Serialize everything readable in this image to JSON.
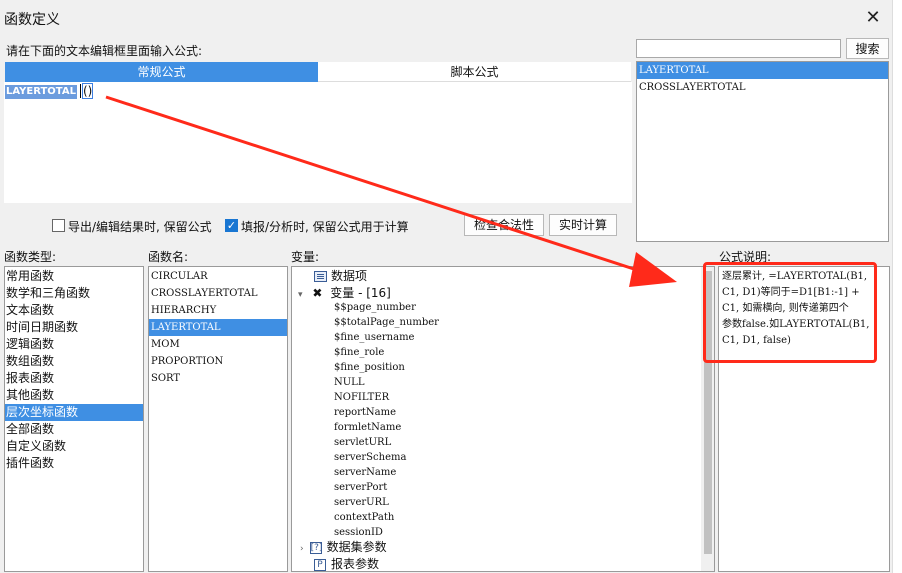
{
  "window": {
    "title": "函数定义",
    "close_label": "✕"
  },
  "prompt": "请在下面的文本编辑框里面输入公式:",
  "tabs": [
    {
      "label": "常规公式"
    },
    {
      "label": "脚本公式"
    }
  ],
  "editor": {
    "selected_text": "LAYERTOTAL",
    "parens": "()"
  },
  "options": {
    "export_keep": {
      "label": "导出/编辑结果时, 保留公式",
      "checked": false
    },
    "fill_keep": {
      "label": "填报/分析时, 保留公式用于计算",
      "checked": true
    }
  },
  "buttons": {
    "check": "检查合法性",
    "realtime": "实时计算",
    "search": "搜索"
  },
  "search": {
    "value": ""
  },
  "search_results": [
    "LAYERTOTAL",
    "CROSSLAYERTOTAL"
  ],
  "labels": {
    "func_type": "函数类型:",
    "func_name": "函数名:",
    "variables": "变量:",
    "description": "公式说明:"
  },
  "func_types": [
    "常用函数",
    "数学和三角函数",
    "文本函数",
    "时间日期函数",
    "逻辑函数",
    "数组函数",
    "报表函数",
    "其他函数",
    "层次坐标函数",
    "全部函数",
    "自定义函数",
    "插件函数"
  ],
  "func_names": [
    "CIRCULAR",
    "CROSSLAYERTOTAL",
    "HIERARCHY",
    "LAYERTOTAL",
    "MOM",
    "PROPORTION",
    "SORT"
  ],
  "variables": {
    "data_item": "数据项",
    "var_group": "变量 - [16]",
    "var_items": [
      "$$page_number",
      "$$totalPage_number",
      "$fine_username",
      "$fine_role",
      "$fine_position",
      "NULL",
      "NOFILTER",
      "reportName",
      "formletName",
      "servletURL",
      "serverSchema",
      "serverName",
      "serverPort",
      "serverURL",
      "contextPath",
      "sessionID"
    ],
    "dataset_params": "数据集参数",
    "report_params": "报表参数"
  },
  "description_lines": [
    "逐层累计, =LAYERTOTAL(B1,",
    "C1, D1)等同于=D1[B1:-1] +",
    "C1, 如需横向, 则传递第四个",
    "参数false.如LAYERTOTAL(B1,",
    "C1, D1, false)"
  ],
  "colors": {
    "accent": "#3f8fe3",
    "annotation_red": "#ff2a1a"
  }
}
